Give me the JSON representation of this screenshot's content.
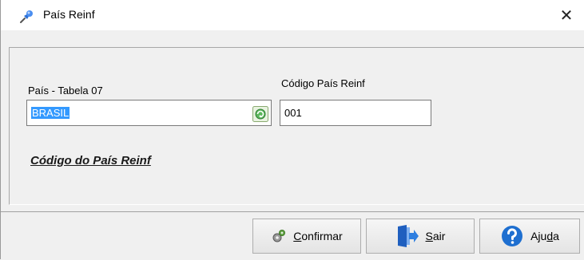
{
  "window": {
    "title": "País Reinf",
    "title_icon": "pushpin-icon",
    "close_glyph": "✕"
  },
  "form": {
    "country_label": "País - Tabela 07",
    "country_value": "BRASIL",
    "code_label": "Código País Reinf",
    "code_value": "001",
    "link_text": "Código do País Reinf"
  },
  "buttons": {
    "confirm": {
      "prefix": "",
      "hotkey": "C",
      "rest": "onfirmar",
      "icon": "gears-icon"
    },
    "exit": {
      "prefix": "",
      "hotkey": "S",
      "rest": "air",
      "icon": "exit-door-icon"
    },
    "help": {
      "prefix": "Aju",
      "hotkey": "d",
      "rest": "a",
      "icon": "help-icon"
    }
  },
  "colors": {
    "selection": "#3399ff",
    "help_blue": "#1e6fd0",
    "exit_blue": "#2060c0",
    "refresh_green": "#4caf50"
  }
}
